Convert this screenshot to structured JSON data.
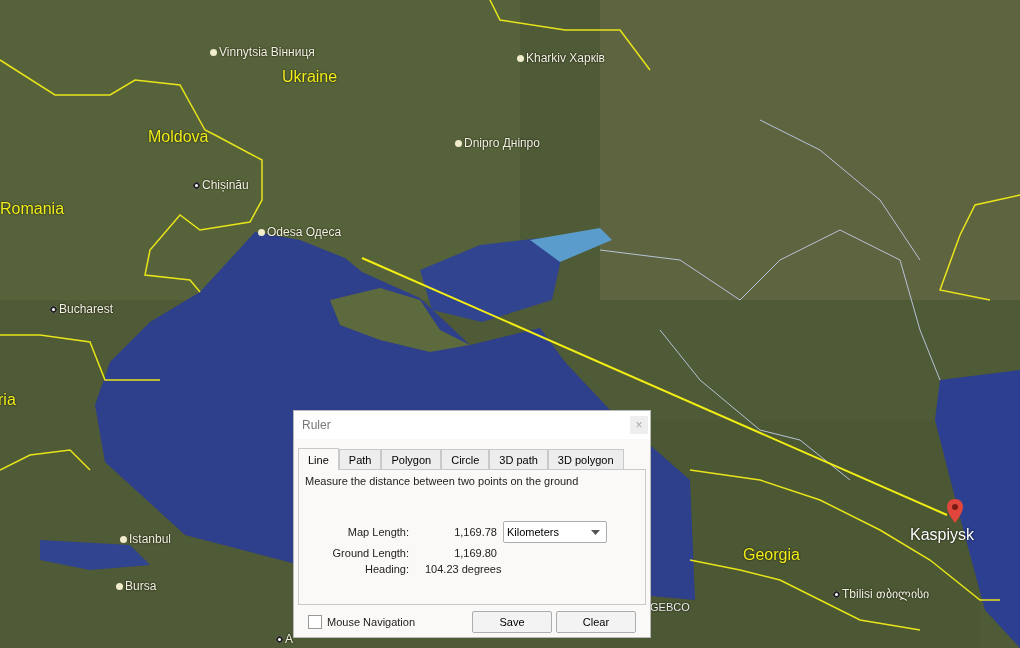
{
  "map": {
    "labels": [
      {
        "kind": "city",
        "text": "Vinnytsia Вінниця"
      },
      {
        "kind": "city",
        "text": "Kharkiv Харків"
      },
      {
        "kind": "country",
        "text": "Ukraine"
      },
      {
        "kind": "city",
        "text": "Dnipro Дніпро"
      },
      {
        "kind": "country",
        "text": "Moldova"
      },
      {
        "kind": "capital",
        "text": "Chișinău"
      },
      {
        "kind": "country",
        "text": "Romania"
      },
      {
        "kind": "city",
        "text": "Odesa Одеса"
      },
      {
        "kind": "capital",
        "text": "Bucharest"
      },
      {
        "kind": "country",
        "text": "ria"
      },
      {
        "kind": "city",
        "text": "Istanbul"
      },
      {
        "kind": "city",
        "text": "Bursa"
      },
      {
        "kind": "capital",
        "text": "A"
      },
      {
        "kind": "credit",
        "text": "GEBCO"
      },
      {
        "kind": "country",
        "text": "Georgia"
      },
      {
        "kind": "capital",
        "text": "Tbilisi თბილისი"
      },
      {
        "kind": "place",
        "text": "Kaspiysk"
      }
    ]
  },
  "dialog": {
    "title": "Ruler",
    "close": "×",
    "tabs": [
      {
        "label": "Line",
        "selected": true
      },
      {
        "label": "Path",
        "selected": false
      },
      {
        "label": "Polygon",
        "selected": false
      },
      {
        "label": "Circle",
        "selected": false
      },
      {
        "label": "3D path",
        "selected": false
      },
      {
        "label": "3D polygon",
        "selected": false
      }
    ],
    "description": "Measure the distance between two points on the ground",
    "rows": [
      {
        "label": "Map Length:",
        "value": "1,169.78"
      },
      {
        "label": "Ground Length:",
        "value": "1,169.80"
      },
      {
        "label": "Heading:",
        "value": "104.23 degrees"
      }
    ],
    "unit": "Kilometers",
    "mouse_navigation": {
      "label": "Mouse Navigation",
      "checked": false
    },
    "buttons": [
      "Save",
      "Clear"
    ]
  }
}
